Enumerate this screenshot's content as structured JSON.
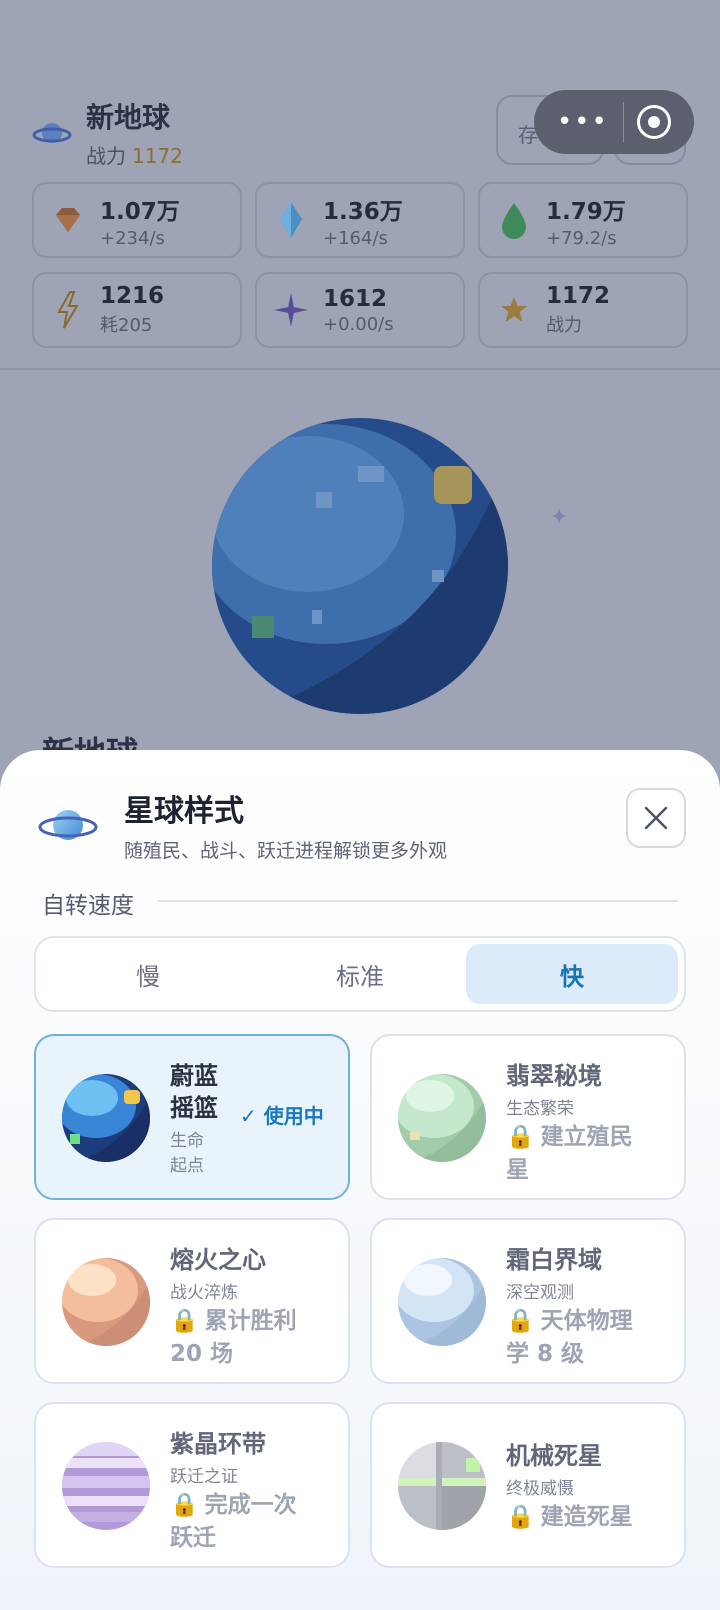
{
  "background": {
    "planet_name": "新地球",
    "power_label": "战力",
    "power_value": "1172",
    "save_button": "存档",
    "capsule_menu": "more-dots-icon",
    "capsule_target": "target-icon",
    "resources": [
      {
        "icon": "mineral-gem-icon",
        "value": "1.07万",
        "rate": "+234/s"
      },
      {
        "icon": "crystal-icon",
        "value": "1.36万",
        "rate": "+164/s"
      },
      {
        "icon": "water-drop-icon",
        "value": "1.79万",
        "rate": "+79.2/s"
      },
      {
        "icon": "lightning-icon",
        "value": "1216",
        "rate": "耗205"
      },
      {
        "icon": "sparkle-star-icon",
        "value": "1612",
        "rate": "+0.00/s"
      },
      {
        "icon": "star-icon",
        "value": "1172",
        "rate": "战力"
      }
    ],
    "bottom_title_partial": "新地球"
  },
  "sheet": {
    "title": "星球样式",
    "subtitle": "随殖民、战斗、跃迁进程解锁更多外观",
    "speed_label": "自转速度",
    "speed_options": [
      "慢",
      "标准",
      "快"
    ],
    "speed_selected": "快",
    "styles": [
      {
        "name": "蔚蓝摇篮",
        "name_l1": "蔚蓝",
        "name_l2": "摇篮",
        "tag": "生命起点",
        "tag_l1": "生命",
        "tag_l2": "起点",
        "status": "✓ 使用中",
        "selected": true
      },
      {
        "name": "翡翠秘境",
        "tag": "生态繁荣",
        "lock": "🔒 建立殖民星",
        "lock_l1": "建立殖民",
        "lock_l2": "星"
      },
      {
        "name": "熔火之心",
        "tag": "战火淬炼",
        "lock": "🔒 累计胜利 20 场",
        "lock_l1": "累计胜利",
        "lock_l2": "20 场"
      },
      {
        "name": "霜白界域",
        "tag": "深空观测",
        "lock": "🔒 天体物理学 8 级",
        "lock_l1": "天体物理",
        "lock_l2": "学 8 级"
      },
      {
        "name": "紫晶环带",
        "tag": "跃迁之证",
        "lock": "🔒 完成一次跃迁",
        "lock_l1": "完成一次",
        "lock_l2": "跃迁"
      },
      {
        "name": "机械死星",
        "tag": "终极威慑",
        "lock": "🔒 建造死星",
        "lock_l1": "建造死星",
        "lock_l2": ""
      }
    ]
  },
  "colors": {
    "accent": "#1774b6",
    "selected_bg": "#e8f3fc",
    "selected_border": "#6fb2d8",
    "lock": "#e2a23a"
  }
}
